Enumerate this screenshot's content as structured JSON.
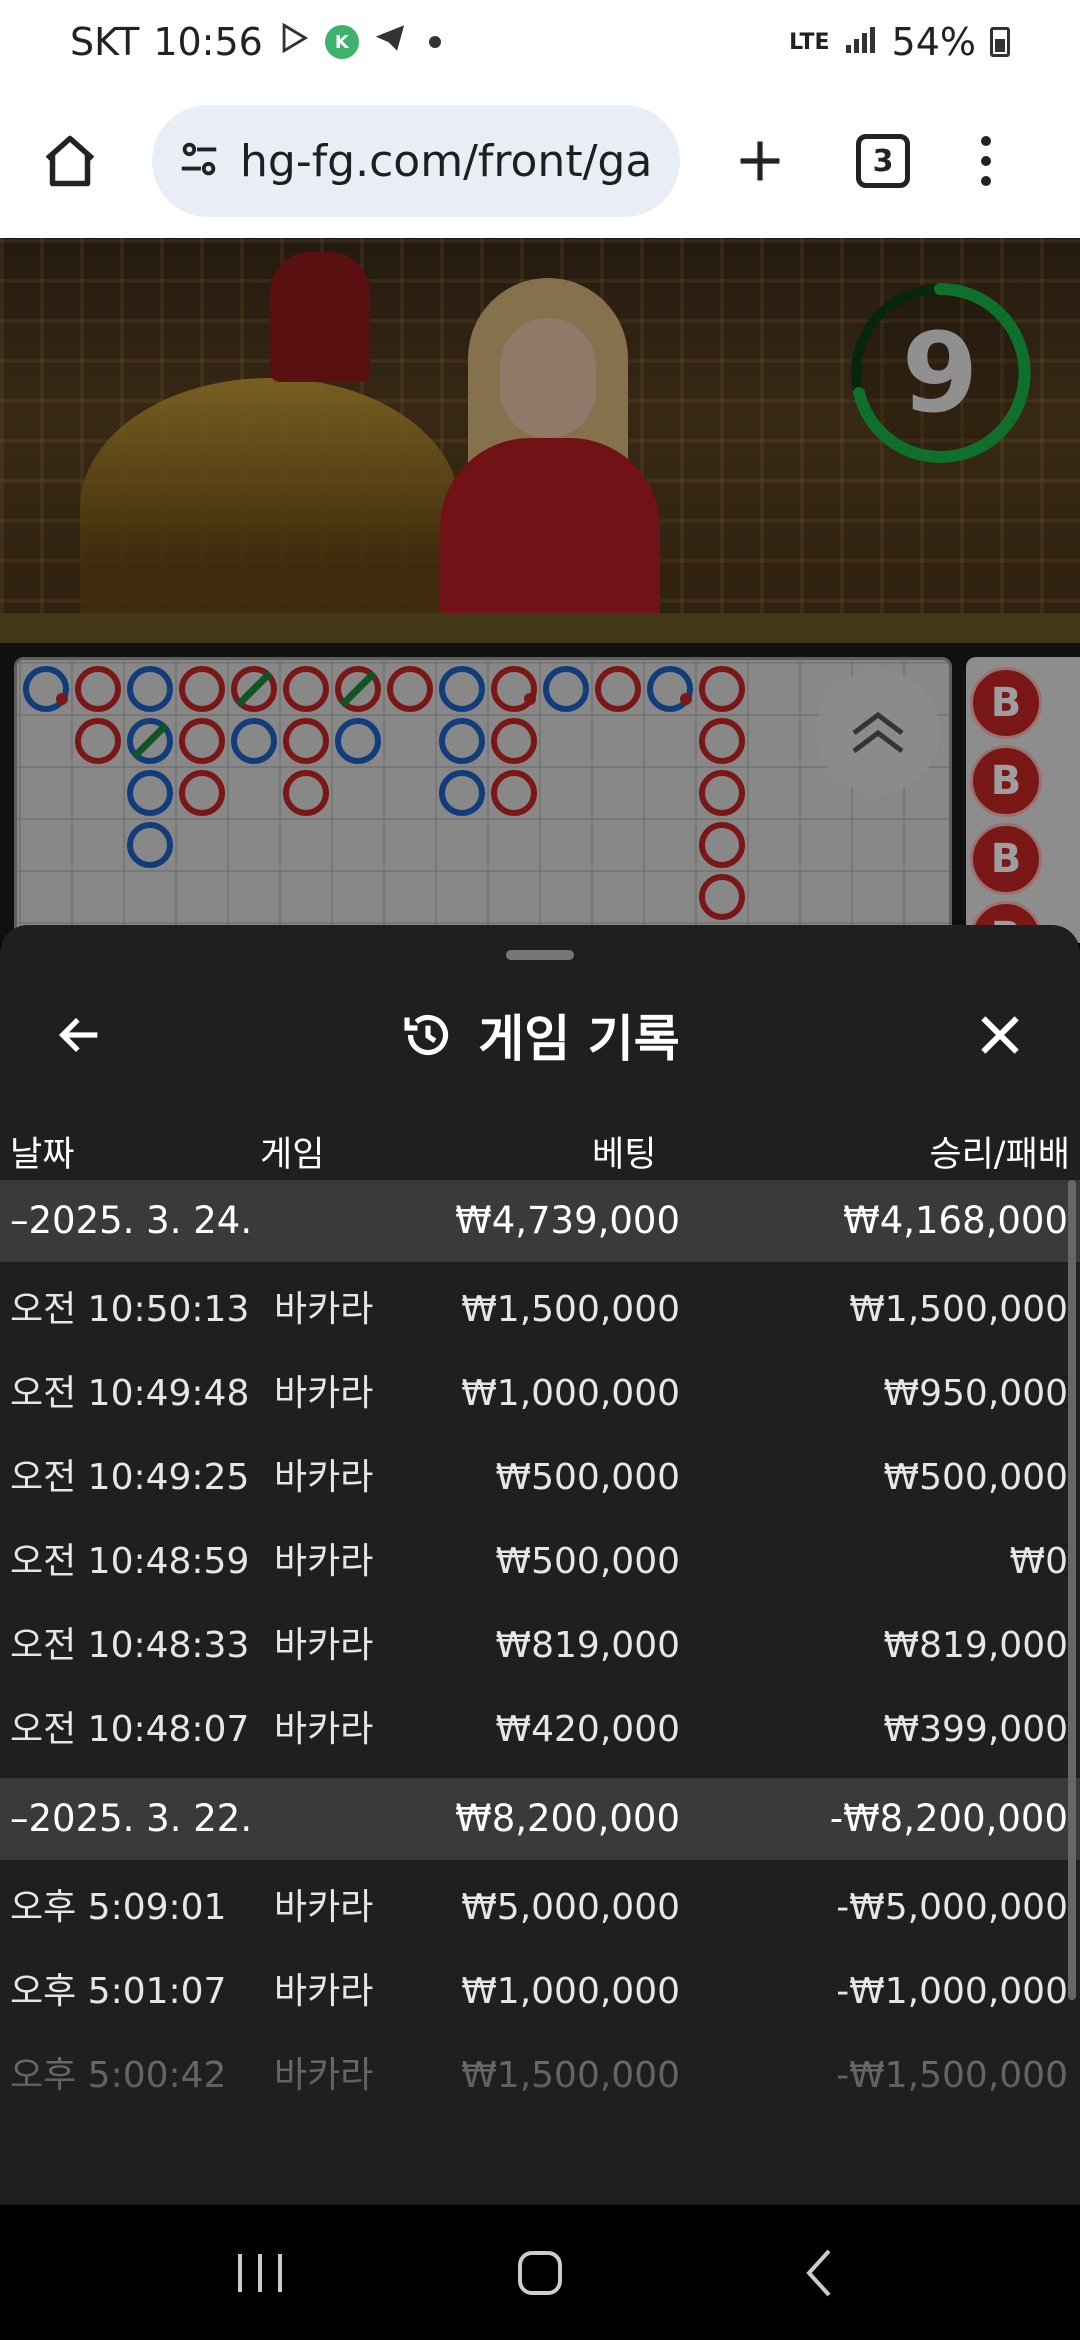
{
  "status_bar": {
    "carrier": "SKT",
    "time": "10:56",
    "network": "LTE",
    "battery": "54%"
  },
  "browser": {
    "url": "hg-fg.com/front/gam",
    "tab_count": "3"
  },
  "video": {
    "countdown": "9"
  },
  "side_road": {
    "label": "B"
  },
  "sheet": {
    "title": "게임 기록",
    "columns": {
      "date": "날짜",
      "game": "게임",
      "bet": "베팅",
      "win_loss": "승리/패배"
    },
    "groups": [
      {
        "date": "–2025. 3. 24.",
        "bet": "₩4,739,000",
        "win_loss": "₩4,168,000",
        "rows": [
          {
            "time": "오전 10:50:13",
            "game": "바카라",
            "bet": "₩1,500,000",
            "win_loss": "₩1,500,000"
          },
          {
            "time": "오전 10:49:48",
            "game": "바카라",
            "bet": "₩1,000,000",
            "win_loss": "₩950,000"
          },
          {
            "time": "오전 10:49:25",
            "game": "바카라",
            "bet": "₩500,000",
            "win_loss": "₩500,000"
          },
          {
            "time": "오전 10:48:59",
            "game": "바카라",
            "bet": "₩500,000",
            "win_loss": "₩0"
          },
          {
            "time": "오전 10:48:33",
            "game": "바카라",
            "bet": "₩819,000",
            "win_loss": "₩819,000"
          },
          {
            "time": "오전 10:48:07",
            "game": "바카라",
            "bet": "₩420,000",
            "win_loss": "₩399,000"
          }
        ]
      },
      {
        "date": "–2025. 3. 22.",
        "bet": "₩8,200,000",
        "win_loss": "-₩8,200,000",
        "rows": [
          {
            "time": "오후 5:09:01",
            "game": "바카라",
            "bet": "₩5,000,000",
            "win_loss": "-₩5,000,000"
          },
          {
            "time": "오후 5:01:07",
            "game": "바카라",
            "bet": "₩1,000,000",
            "win_loss": "-₩1,000,000"
          },
          {
            "time": "오후 5:00:42",
            "game": "바카라",
            "bet": "₩1,500,000",
            "win_loss": "-₩1,500,000"
          }
        ]
      }
    ]
  },
  "colors": {
    "banker": "#c62828",
    "player": "#1e63c6",
    "tie": "#1e8a3a",
    "timer": "#19b548"
  }
}
